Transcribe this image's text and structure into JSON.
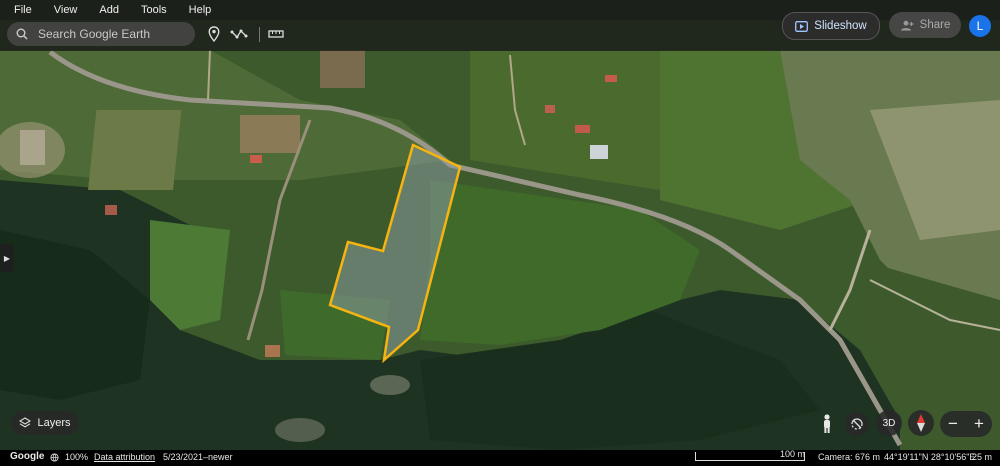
{
  "menu": {
    "items": [
      {
        "label": "File"
      },
      {
        "label": "View"
      },
      {
        "label": "Add"
      },
      {
        "label": "Tools"
      },
      {
        "label": "Help"
      }
    ]
  },
  "search": {
    "placeholder": "Search Google Earth"
  },
  "toolbar": {
    "pin_icon": "map-pin-icon",
    "path_icon": "draw-path-icon",
    "measure_icon": "ruler-icon"
  },
  "header": {
    "slideshow_label": "Slideshow",
    "share_label": "Share",
    "avatar_letter": "L"
  },
  "layers": {
    "label": "Layers"
  },
  "controls": {
    "view_3d": "3D"
  },
  "status": {
    "brand": "Google",
    "zoom": "100%",
    "attribution": "Data attribution",
    "imagery_date": "5/23/2021–newer",
    "scale_label": "100 m",
    "camera": "Camera: 676 m",
    "coordinates": "44°19'11\"N 28°10'56\"E",
    "elevation": "25 m"
  },
  "colors": {
    "accent": "#1a73e8",
    "polygon_stroke": "#f5b40f",
    "polygon_fill": "#8a9aa3"
  }
}
